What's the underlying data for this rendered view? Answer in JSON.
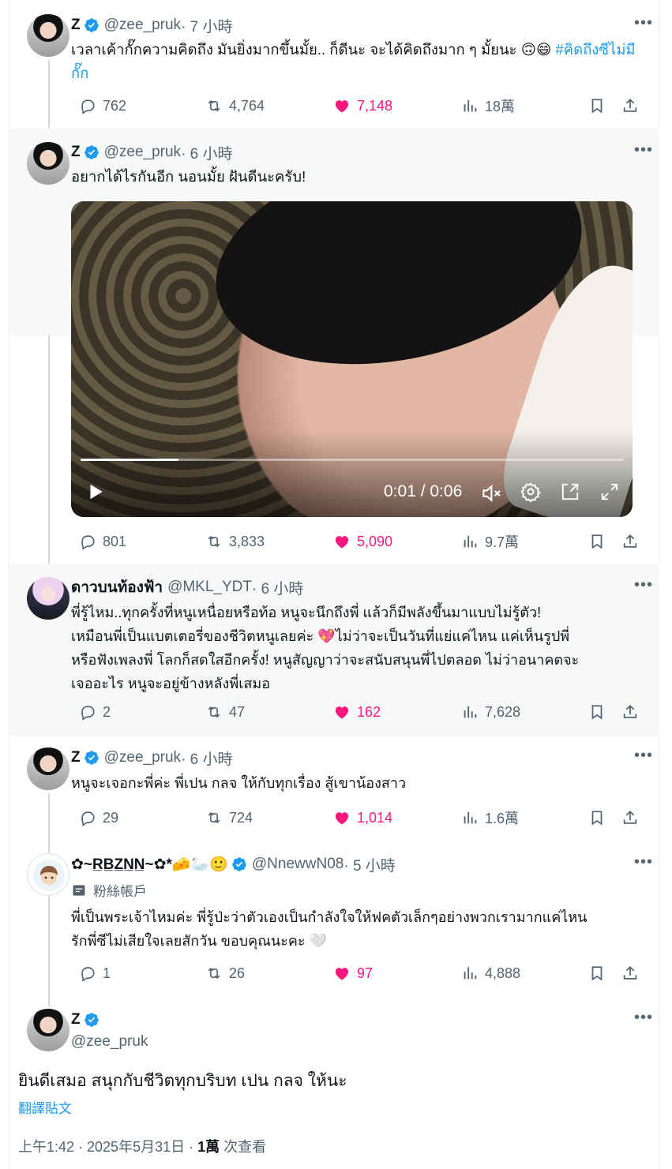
{
  "tweets": [
    {
      "name": "Z",
      "handle": "@zee_pruk",
      "time": " · 7 小時",
      "text": "เวลาเค้ากั๊กความคิดถึง มันยิ่งมากขึ้นมั้ย.. ก็ดีนะ จะได้คิดถึงมาก ๆ มั้ยนะ 🙃😄",
      "hashtag": "#คิดถึงซีไม่มีกั๊ก",
      "replies": "762",
      "reposts": "4,764",
      "likes": "7,148",
      "views": "18萬"
    },
    {
      "name": "Z",
      "handle": "@zee_pruk",
      "time": " · 6 小時",
      "text": "อยากได้ไรกันอีก นอนมั้ย ฝันดีนะครับ!",
      "video": {
        "time": "0:01 / 0:06",
        "progress": 0.18
      },
      "replies": "801",
      "reposts": "3,833",
      "likes": "5,090",
      "views": "9.7萬"
    },
    {
      "name": "ดาวบนท้องฟ้า",
      "handle": "@MKL_YDT",
      "time": " · 6 小時",
      "text_lines": [
        "พี่รู้ไหม..ทุกครั้งที่หนูเหนื่อยหรือท้อ หนูจะนึกถึงพี่ แล้วก็มีพลังขึ้นมาแบบไม่รู้ตัว!",
        "เหมือนพี่เป็นแบตเตอรี่ของชีวิตหนูเลยค่ะ 💖ไม่ว่าจะเป็นวันที่แย่แค่ไหน แค่เห็นรูปพี่",
        "หรือฟังเพลงพี่ โลกก็สดใสอีกครั้ง! หนูสัญญาว่าจะสนับสนุนพี่ไปตลอด ไม่ว่าอนาคตจะ",
        "เจออะไร หนูจะอยู่ข้างหลังพี่เสมอ"
      ],
      "replies": "2",
      "reposts": "47",
      "likes": "162",
      "views": "7,628"
    },
    {
      "name": "Z",
      "handle": "@zee_pruk",
      "time": " · 6 小時",
      "text": "หนูจะเจอกะพี่ค่ะ พี่เปน กลจ ให้กับทุกเรื่อง สู้เขาน้องสาว",
      "replies": "29",
      "reposts": "724",
      "likes": "1,014",
      "views": "1.6萬"
    },
    {
      "name": "✿~R̲B̲Z̲N̲N̲~✿*🧀🦢🙂",
      "handle": "@NnewwN08",
      "time": " · 5 小時",
      "label": "粉絲帳戶",
      "text_lines": [
        "พี่เป็นพระเจ้าไหมค่ะ พี่รู้ป่ะว่าตัวเองเป็นกำลังใจให้ฟคตัวเล็กๆอย่างพวกเรามากแค่ไหน",
        "รักพี่ซีไม่เสียใจเลยสักวัน ขอบคุณนะคะ 🤍"
      ],
      "replies": "1",
      "reposts": "26",
      "likes": "97",
      "views": "4,888"
    }
  ],
  "main": {
    "name": "Z",
    "handle": "@zee_pruk",
    "text": "ยินดีเสมอ สนุกกับชีวิตทุกบริบท เปน กลจ ให้นะ",
    "translate": "翻譯貼文",
    "timestamp": "上午1:42 · 2025年5月31日 · ",
    "views_count": "1萬",
    "views_label": " 次查看"
  },
  "colors": {
    "accent": "#1d9bf0",
    "like": "#f91880",
    "muted": "#536471",
    "highlight": "#f7f9f9"
  },
  "icons": [
    "verified-icon",
    "reply-icon",
    "repost-icon",
    "heart-icon",
    "views-icon",
    "bookmark-icon",
    "share-icon",
    "more-icon",
    "play-icon",
    "mute-icon",
    "settings-icon",
    "pip-icon",
    "fullscreen-icon",
    "fan-account-icon"
  ]
}
